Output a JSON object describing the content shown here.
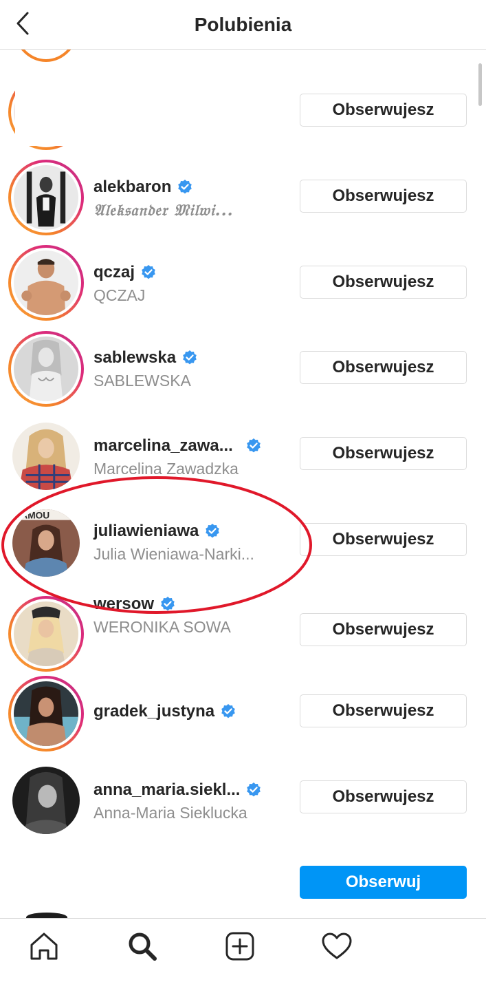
{
  "header": {
    "title": "Polubienia"
  },
  "follow_label": "Obserwujesz",
  "follow_primary_label": "Obserwuj",
  "rows": [
    {
      "username": "alekbaron",
      "fullname": "𝔄𝔩𝔢𝔨𝔰𝔞𝔫𝔡𝔢𝔯 𝔐𝔦𝔩𝔴𝔦...",
      "verified": true
    },
    {
      "username": "qczaj",
      "fullname": "QCZAJ",
      "verified": true
    },
    {
      "username": "sablewska",
      "fullname": "SABLEWSKA",
      "verified": true
    },
    {
      "username": "marcelina_zawa...",
      "fullname": "Marcelina Zawadzka",
      "verified": true
    },
    {
      "username": "juliawieniawa",
      "fullname": "Julia Wieniawa-Narki...",
      "verified": true
    },
    {
      "username": "wersow",
      "fullname": "WERONIKA SOWA",
      "verified": true
    },
    {
      "username": "gradek_justyna",
      "fullname": "",
      "verified": true
    },
    {
      "username": "anna_maria.siekl...",
      "fullname": "Anna-Maria Sieklucka",
      "verified": true
    }
  ],
  "colors": {
    "accent": "#0095f6",
    "verified": "#3897f0",
    "annotation": "#e0182a"
  },
  "icons": {
    "back": "chevron-left-icon",
    "home": "home-icon",
    "search": "search-icon",
    "add": "add-post-icon",
    "activity": "heart-icon"
  }
}
